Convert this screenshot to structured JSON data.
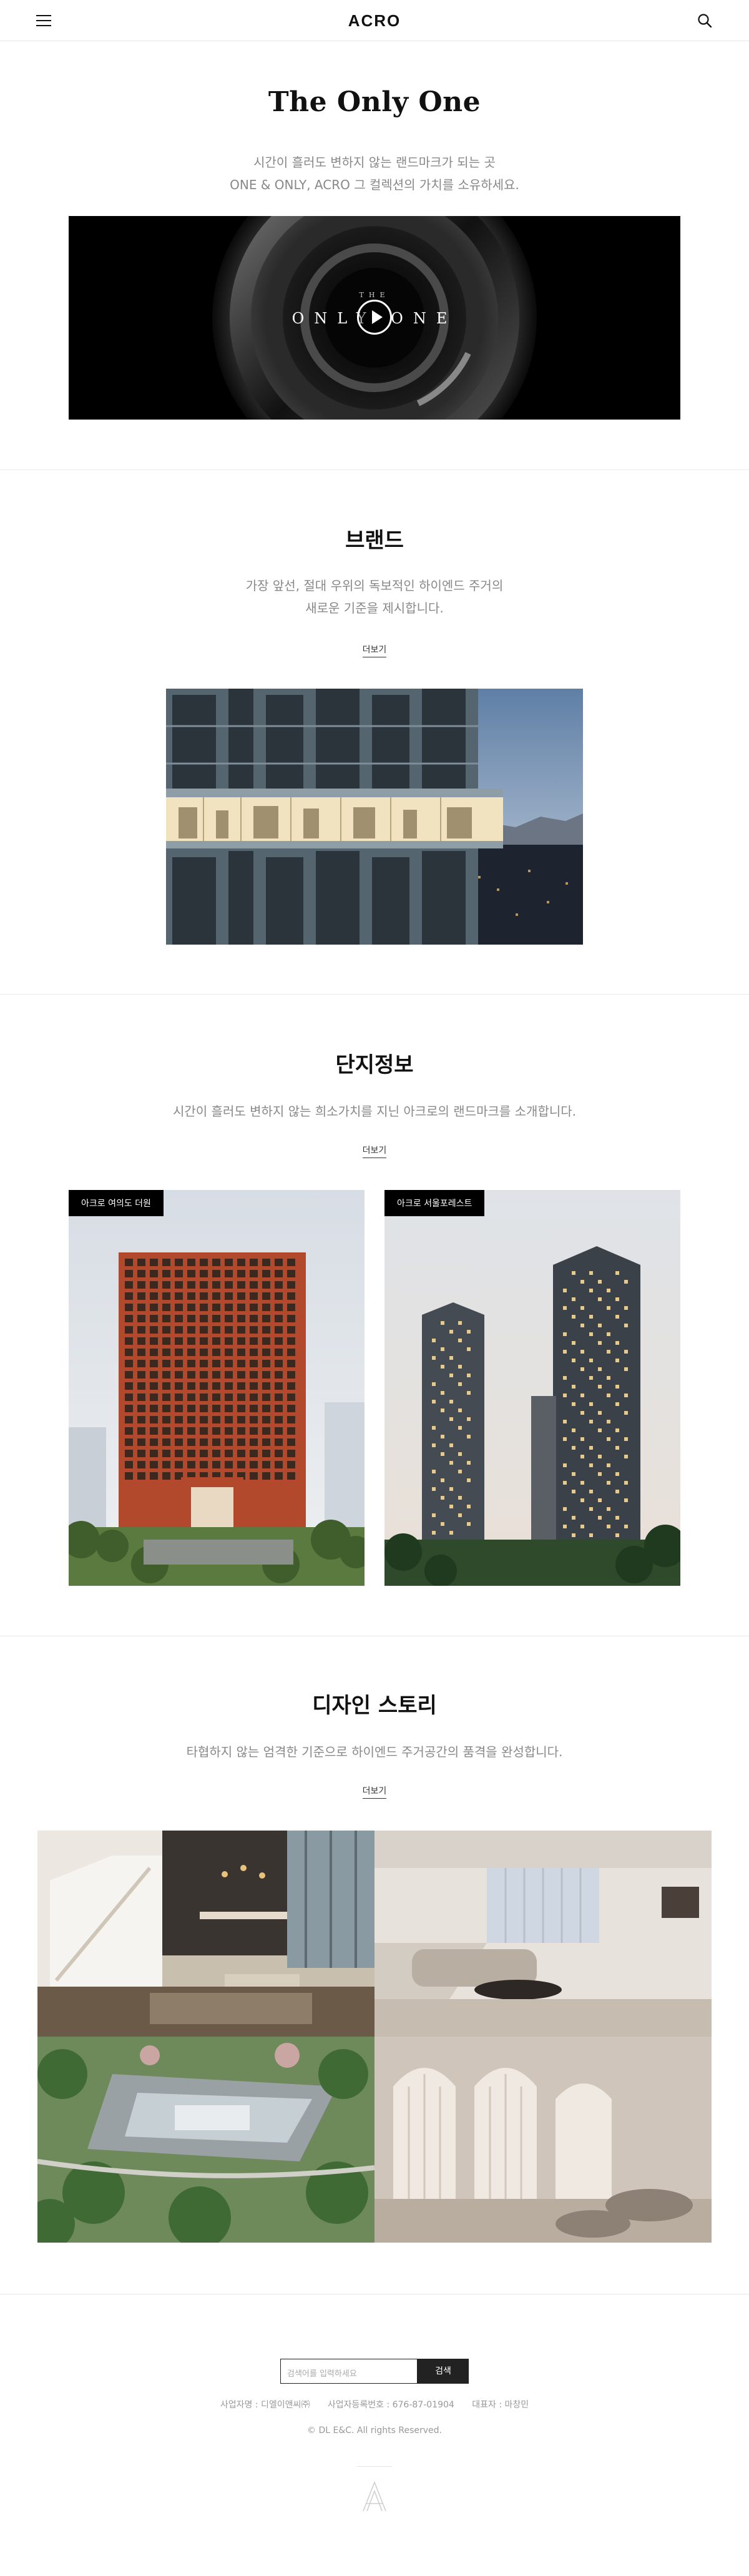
{
  "header": {
    "logo": "ACRO"
  },
  "hero": {
    "title": "The Only One",
    "desc_line1": "시간이 흘러도 변하지 않는 랜드마크가 되는 곳",
    "desc_line2": "ONE & ONLY, ACRO 그 컬렉션의 가치를 소유하세요.",
    "video_small": "THE",
    "video_text": "ONLY ONE"
  },
  "brand": {
    "title": "브랜드",
    "desc_line1": "가장 앞선, 절대 우위의 독보적인 하이엔드 주거의",
    "desc_line2": "새로운 기준을 제시합니다.",
    "more": "더보기"
  },
  "complex": {
    "title": "단지정보",
    "desc": "시간이 흘러도 변하지 않는 희소가치를 지닌 아크로의 랜드마크를 소개합니다.",
    "more": "더보기",
    "cards": [
      {
        "tag": "아크로 여의도 더원"
      },
      {
        "tag": "아크로 서울포레스트"
      }
    ]
  },
  "design": {
    "title": "디자인 스토리",
    "desc": "타협하지 않는 엄격한 기준으로 하이엔드 주거공간의 품격을 완성합니다.",
    "more": "더보기"
  },
  "footer": {
    "search_placeholder": "검색어를 입력하세요",
    "search_button": "검색",
    "company": "사업자명 : 디엘이앤씨㈜",
    "reg_no": "사업자등록번호 : 676-87-01904",
    "ceo": "대표자 : 마창민",
    "copyright": "© DL E&C. All rights Reserved."
  },
  "colors": {
    "text": "#111111",
    "muted": "#888888",
    "divider": "#e8e8e8",
    "tag_bg": "#000000"
  }
}
